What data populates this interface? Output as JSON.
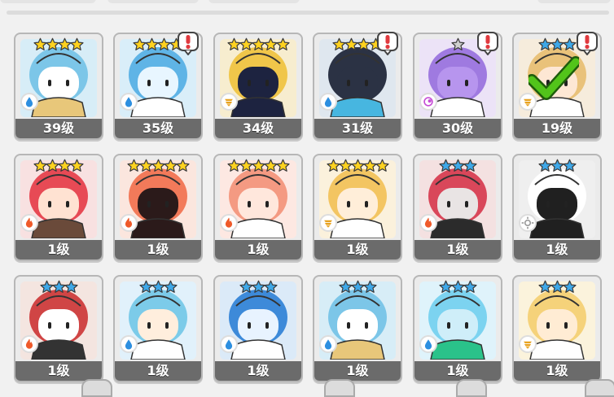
{
  "colors": {
    "gold_star": "#ffd21f",
    "blue_star": "#3fa8e8",
    "silver_star": "#cfcfcf",
    "alert_red": "#e0393e",
    "check_green": "#52c41a",
    "level_bar": "#6b6b6b"
  },
  "cards": [
    {
      "level": "39级",
      "stars": 4,
      "star_color": "gold",
      "element": "water",
      "alert": false,
      "check": false,
      "hero": "pharaoh-blue"
    },
    {
      "level": "35级",
      "stars": 4,
      "star_color": "gold",
      "element": "water",
      "alert": true,
      "check": false,
      "hero": "bird-knight"
    },
    {
      "level": "34级",
      "stars": 5,
      "star_color": "gold",
      "element": "earth",
      "alert": false,
      "check": false,
      "hero": "golden-hood"
    },
    {
      "level": "31级",
      "stars": 4,
      "star_color": "gold",
      "element": "water",
      "alert": true,
      "check": false,
      "hero": "horned-demon"
    },
    {
      "level": "30级",
      "stars": 1,
      "star_color": "silver",
      "element": "arcane",
      "alert": true,
      "check": false,
      "hero": "purple-cat"
    },
    {
      "level": "19级",
      "stars": 3,
      "star_color": "blue",
      "element": "earth",
      "alert": true,
      "check": true,
      "hero": "maid"
    },
    {
      "level": "1级",
      "stars": 4,
      "star_color": "gold",
      "element": "fire",
      "alert": false,
      "check": false,
      "hero": "red-imp"
    },
    {
      "level": "1级",
      "stars": 5,
      "star_color": "gold",
      "element": "fire",
      "alert": false,
      "check": false,
      "hero": "flame-hood"
    },
    {
      "level": "1级",
      "stars": 5,
      "star_color": "gold",
      "element": "fire",
      "alert": false,
      "check": false,
      "hero": "coral-girl"
    },
    {
      "level": "1级",
      "stars": 5,
      "star_color": "gold",
      "element": "earth",
      "alert": false,
      "check": false,
      "hero": "sun-priestess"
    },
    {
      "level": "1级",
      "stars": 3,
      "star_color": "blue",
      "element": "fire",
      "alert": false,
      "check": false,
      "hero": "red-dragon"
    },
    {
      "level": "1级",
      "stars": 3,
      "star_color": "blue",
      "element": "light",
      "alert": false,
      "check": false,
      "hero": "white-hood"
    },
    {
      "level": "1级",
      "stars": 3,
      "star_color": "blue",
      "element": "fire",
      "alert": false,
      "check": false,
      "hero": "wolf-pirate"
    },
    {
      "level": "1级",
      "stars": 3,
      "star_color": "blue",
      "element": "water",
      "alert": false,
      "check": false,
      "hero": "ice-maiden"
    },
    {
      "level": "1级",
      "stars": 3,
      "star_color": "blue",
      "element": "water",
      "alert": false,
      "check": false,
      "hero": "clock-gear"
    },
    {
      "level": "1级",
      "stars": 3,
      "star_color": "blue",
      "element": "water",
      "alert": false,
      "check": false,
      "hero": "pharaoh-blue"
    },
    {
      "level": "1级",
      "stars": 3,
      "star_color": "blue",
      "element": "water",
      "alert": false,
      "check": false,
      "hero": "mermaid"
    },
    {
      "level": "1级",
      "stars": 3,
      "star_color": "blue",
      "element": "earth",
      "alert": false,
      "check": false,
      "hero": "golden-king"
    }
  ]
}
